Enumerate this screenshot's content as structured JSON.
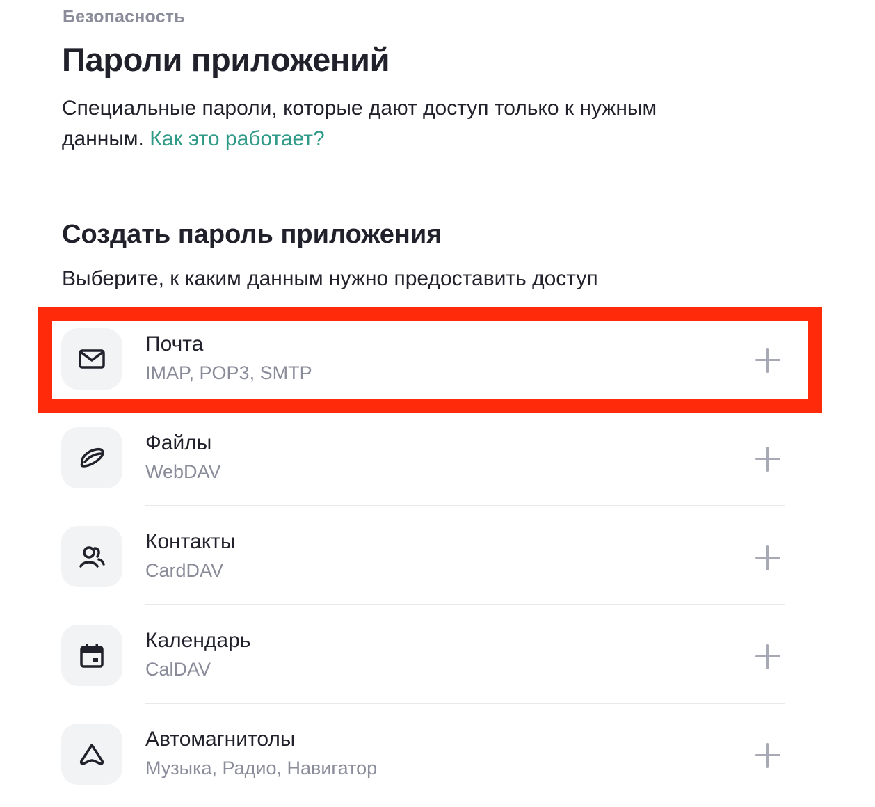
{
  "breadcrumb": "Безопасность",
  "page_title": "Пароли приложений",
  "description": {
    "text": "Специальные пароли, которые дают доступ только к нужным данным.",
    "link": "Как это работает?"
  },
  "create_section": {
    "title": "Создать пароль приложения",
    "subtitle": "Выберите, к каким данным нужно предоставить доступ"
  },
  "items": [
    {
      "title": "Почта",
      "subtitle": "IMAP, POP3, SMTP",
      "icon": "mail-icon"
    },
    {
      "title": "Файлы",
      "subtitle": "WebDAV",
      "icon": "disk-icon"
    },
    {
      "title": "Контакты",
      "subtitle": "CardDAV",
      "icon": "contacts-icon"
    },
    {
      "title": "Календарь",
      "subtitle": "CalDAV",
      "icon": "calendar-icon"
    },
    {
      "title": "Автомагнитолы",
      "subtitle": "Музыка, Радио, Навигатор",
      "icon": "car-icon"
    }
  ],
  "colors": {
    "link": "#2f9a87",
    "highlight": "#ff2a0a",
    "muted_text": "#8a8c9a"
  }
}
